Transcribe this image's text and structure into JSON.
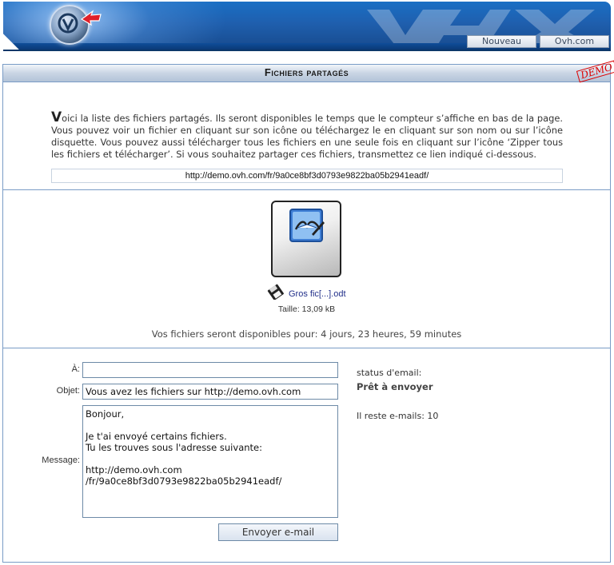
{
  "header": {
    "nav": {
      "nouveau_label": "Nouveau",
      "ovh_label": "Ovh.com"
    },
    "icons": [
      "ovh-logo-icon",
      "red-arrow-icon"
    ]
  },
  "panel": {
    "title": "Fichiers partagés",
    "demo_stamp": "DEMO",
    "intro_first_letter": "V",
    "intro_text": "oici la liste des fichiers partagés. Ils seront disponibles le temps que le compteur s’affiche en bas de la page. Vous pouvez voir un fichier en cliquant sur son icône ou téléchargez le en cliquant sur son nom ou sur l’icône disquette. Vous pouvez aussi télécharger tous les fichiers en une seule fois en cliquant sur l’icône ‘Zipper tous les fichiers et télécharger’. Si vous souhaitez partager ces fichiers, transmettez ce lien indiqué ci-dessous.",
    "share_link": "http://demo.ovh.com/fr/9a0ce8bf3d0793e9822ba05b2941eadf/"
  },
  "file": {
    "icon": "openoffice-writer-icon",
    "name": "Gros fic[...].odt",
    "size": "Taille: 13,09 kB"
  },
  "availability": "Vos fichiers seront disponibles pour: 4 jours, 23 heures, 59 minutes",
  "form": {
    "to_label": "À:",
    "to_value": "",
    "subject_label": "Objet:",
    "subject_value": "Vous avez les fichiers sur http://demo.ovh.com",
    "message_label": "Message:",
    "message_value": "Bonjour,\n\nJe t'ai envoyé certains fichiers.\nTu les trouves sous l'adresse suivante:\n\nhttp://demo.ovh.com\n/fr/9a0ce8bf3d0793e9822ba05b2941eadf/",
    "send_label": "Envoyer e-mail"
  },
  "status": {
    "label": "status d'email:",
    "value": "Prêt à envoyer",
    "remaining": "Il reste e-mails: 10"
  },
  "colors": {
    "header_blue": "#1f5fae",
    "border_blue": "#7a9cc6",
    "link_blue": "#22308a",
    "demo_red": "#dd0000"
  }
}
